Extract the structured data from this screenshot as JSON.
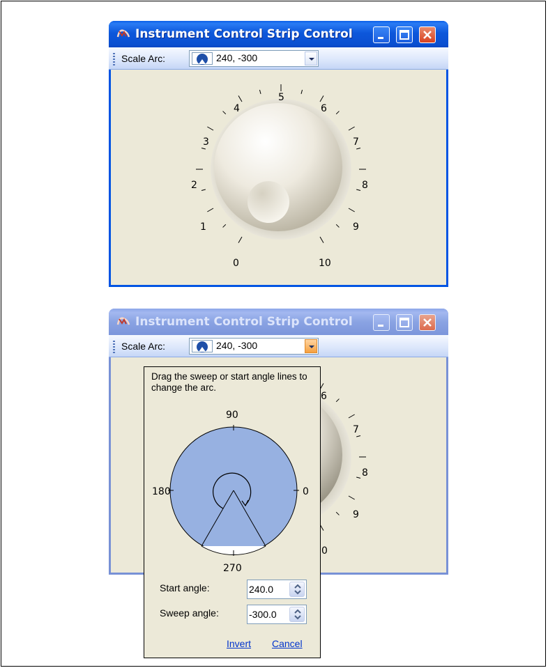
{
  "windows": [
    {
      "title": "Instrument Control Strip Control",
      "toolbar": {
        "label": "Scale Arc:",
        "combo_value": "240, -300"
      },
      "knob_scale": [
        "0",
        "1",
        "2",
        "3",
        "4",
        "5",
        "6",
        "7",
        "8",
        "9",
        "10"
      ]
    },
    {
      "title": "Instrument Control Strip Control",
      "toolbar": {
        "label": "Scale Arc:",
        "combo_value": "240, -300"
      },
      "knob_scale_visible": [
        "6",
        "7",
        "8",
        "9",
        "0"
      ]
    }
  ],
  "popup": {
    "hint": "Drag the sweep or start angle lines to change the arc.",
    "dial": {
      "label_90": "90",
      "label_180": "180",
      "label_0": "0",
      "label_270": "270",
      "fill_color": "#97b1e1"
    },
    "start_angle_label": "Start angle:",
    "start_angle_value": "240.0",
    "sweep_angle_label": "Sweep angle:",
    "sweep_angle_value": "-300.0",
    "invert_link": "Invert",
    "cancel_link": "Cancel"
  },
  "colors": {
    "titlebar_active": "#0a54e0",
    "titlebar_inactive": "#8aa3e3",
    "window_bg": "#ece9d8",
    "close_button": "#d9411f"
  },
  "icons": [
    "app-icon",
    "minimize-icon",
    "maximize-icon",
    "close-icon",
    "scale-arc-icon",
    "dropdown-arrow-icon",
    "spinner-icon"
  ]
}
